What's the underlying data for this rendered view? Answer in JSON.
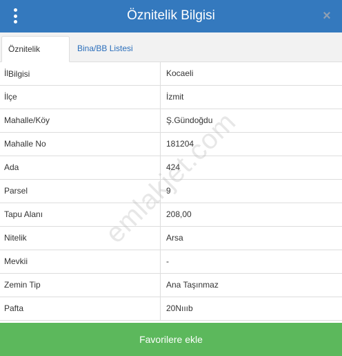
{
  "header": {
    "title": "Öznitelik Bilgisi",
    "close_glyph": "×",
    "menu_icon": "vertical-ellipsis-icon",
    "color": "#3479be"
  },
  "tabs": [
    {
      "label": "Öznitelik Bilgisi",
      "active": true
    },
    {
      "label": "Bina/BB Listesi",
      "active": false
    }
  ],
  "rows": [
    {
      "key": "İl",
      "value": "Kocaeli"
    },
    {
      "key": "İlçe",
      "value": "İzmit"
    },
    {
      "key": "Mahalle/Köy",
      "value": "Ş.Gündoğdu"
    },
    {
      "key": "Mahalle No",
      "value": "181204"
    },
    {
      "key": "Ada",
      "value": "424"
    },
    {
      "key": "Parsel",
      "value": "9"
    },
    {
      "key": "Tapu Alanı",
      "value": "208,00"
    },
    {
      "key": "Nitelik",
      "value": "Arsa"
    },
    {
      "key": "Mevkii",
      "value": "-"
    },
    {
      "key": "Zemin Tip",
      "value": "Ana Taşınmaz"
    },
    {
      "key": "Pafta",
      "value": "20Nıııb"
    }
  ],
  "watermark": "emlakjet.com",
  "footer": {
    "button_label": "Favorilere ekle",
    "color": "#5cb85c"
  }
}
